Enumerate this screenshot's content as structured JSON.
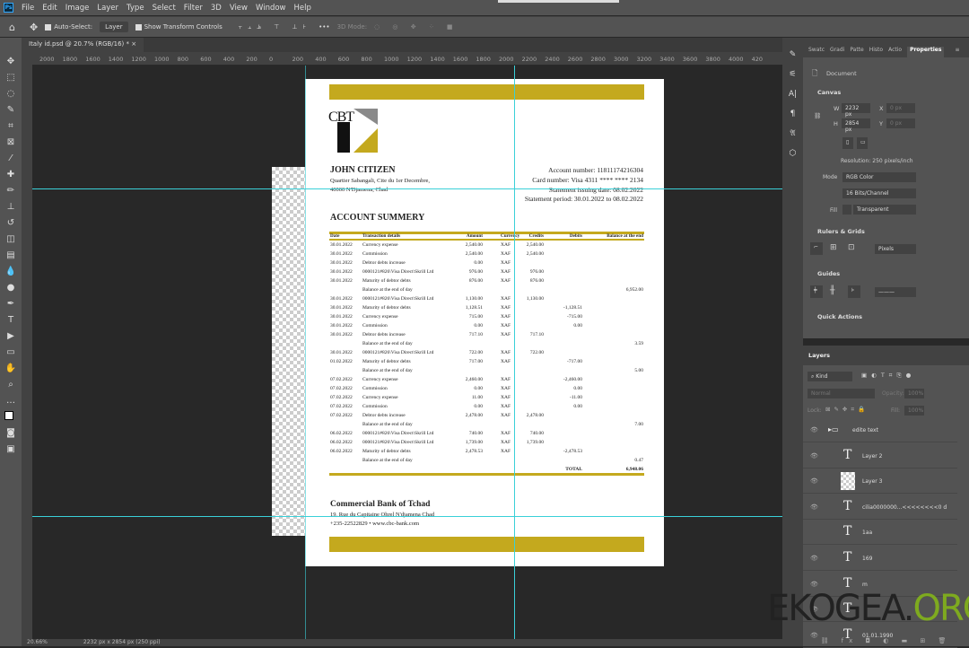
{
  "menu": [
    "File",
    "Edit",
    "Image",
    "Layer",
    "Type",
    "Select",
    "Filter",
    "3D",
    "View",
    "Window",
    "Help"
  ],
  "options": {
    "auto_select": "Auto-Select:",
    "layer_select": "Layer",
    "show_transform": "Show Transform Controls",
    "mode_3d": "3D Mode:"
  },
  "tab": {
    "title": "Italy id.psd @ 20.7% (RGB/16) *",
    "close": "×"
  },
  "ruler_labels": [
    "2000",
    "1800",
    "1600",
    "1400",
    "1200",
    "1000",
    "800",
    "600",
    "400",
    "200",
    "0",
    "200",
    "400",
    "600",
    "800",
    "1000",
    "1200",
    "1400",
    "1600",
    "1800",
    "2000",
    "2200",
    "2400",
    "2600",
    "2800",
    "3000",
    "3200",
    "3400",
    "3600",
    "3800",
    "4000",
    "420"
  ],
  "status": {
    "zoom": "20.66%",
    "doc": "2232 px x 2854 px (250 ppi)"
  },
  "document": {
    "logo_text": "CBT",
    "name": "JOHN CITIZEN",
    "address1": "Quartier Sabangali, Cite du 1er Decembre,",
    "address2": "40000 N'Djamena, Chad",
    "account": "Account number: 11811174216304",
    "card": "Card number: Visa 4311 **** **** 2134",
    "issue": "Statement issuing date: 08.02.2022",
    "period": "Statement period: 30.01.2022 to 08.02.2022",
    "summary_title": "ACCOUNT SUMMERY",
    "columns": [
      "Date",
      "Transaction details",
      "Amount",
      "Currency",
      "Credits",
      "Debits",
      "Balance at the end"
    ],
    "rows": [
      [
        "30.01.2022",
        "Currency expense",
        "2,540.00",
        "XAF",
        "2,540.00",
        "",
        ""
      ],
      [
        "30.01.2022",
        "Commission",
        "2,540.00",
        "XAF",
        "2,540.00",
        "",
        ""
      ],
      [
        "30.01.2022",
        "Debtor debts increase",
        "0.00",
        "XAF",
        "",
        "",
        ""
      ],
      [
        "30.01.2022",
        "0000121#826\\Visa Direct\\Skrill Ltd",
        "976.00",
        "XAF",
        "976.00",
        "",
        ""
      ],
      [
        "30.01.2022",
        "Maturity of debtor debts",
        "876.00",
        "XAF",
        "876.00",
        "",
        ""
      ],
      [
        "",
        "Balance at the end of day",
        "",
        "",
        "",
        "",
        "6,952.00"
      ],
      [
        "30.01.2022",
        "0000121#826\\Visa Direct\\Skrill Ltd",
        "1,130.00",
        "XAF",
        "1,130.00",
        "",
        ""
      ],
      [
        "30.01.2022",
        "Maturity of debtor debts",
        "1,128.51",
        "XAF",
        "",
        "-1,128.51",
        ""
      ],
      [
        "30.01.2022",
        "Currency expense",
        "715.00",
        "XAF",
        "",
        "-715.00",
        ""
      ],
      [
        "30.01.2022",
        "Commission",
        "0.00",
        "XAF",
        "",
        "0.00",
        ""
      ],
      [
        "30.01.2022",
        "Debtor debts increase",
        "717.10",
        "XAF",
        "717.10",
        "",
        ""
      ],
      [
        "",
        "Balance at the end of day",
        "",
        "",
        "",
        "",
        "3.59"
      ],
      [
        "30.01.2022",
        "0000121#826\\Visa Direct\\Skrill Ltd",
        "722.00",
        "XAF",
        "722.00",
        "",
        ""
      ],
      [
        "01.02.2022",
        "Maturity of debtor debts",
        "717.00",
        "XAF",
        "",
        "-717.00",
        ""
      ],
      [
        "",
        "Balance at the end of day",
        "",
        "",
        "",
        "",
        "5.00"
      ],
      [
        "07.02.2022",
        "Currency expense",
        "2,460.00",
        "XAF",
        "",
        "-2,460.00",
        ""
      ],
      [
        "07.02.2022",
        "Commission",
        "0.00",
        "XAF",
        "",
        "0.00",
        ""
      ],
      [
        "07.02.2022",
        "Currency expense",
        "11.00",
        "XAF",
        "",
        "-11.00",
        ""
      ],
      [
        "07.02.2022",
        "Commission",
        "0.00",
        "XAF",
        "",
        "0.00",
        ""
      ],
      [
        "07.02.2022",
        "Debtor debts increase",
        "2,478.00",
        "XAF",
        "2,478.00",
        "",
        ""
      ],
      [
        "",
        "Balance at the end of day",
        "",
        "",
        "",
        "",
        "7.00"
      ],
      [
        "06.02.2022",
        "0000121#826\\Visa Direct\\Skrill Ltd",
        "740.00",
        "XAF",
        "740.00",
        "",
        ""
      ],
      [
        "06.02.2022",
        "0000121#826\\Visa Direct\\Skrill Ltd",
        "1,739.00",
        "XAF",
        "1,739.00",
        "",
        ""
      ],
      [
        "06.02.2022",
        "Maturity of debtor debts",
        "2,478.53",
        "XAF",
        "",
        "-2,478.53",
        ""
      ],
      [
        "",
        "Balance at the end of day",
        "",
        "",
        "",
        "",
        "0.47"
      ]
    ],
    "total_label": "TOTAL",
    "total_value": "6,948.06",
    "bank_name": "Commercial Bank of Tchad",
    "bank_address": "19, Rue du Capitaine Ohrel N'djamena Chad",
    "bank_contact": "+235-22522829 • www.cbc-bank.com",
    "gold": "#c4a91e"
  },
  "properties": {
    "tabs": [
      "Swatc",
      "Gradi",
      "Patte",
      "Histo",
      "Actio",
      "Properties"
    ],
    "document_label": "Document",
    "canvas_title": "Canvas",
    "w_label": "W",
    "w": "2232 px",
    "h_label": "H",
    "h": "2854 px",
    "x_label": "X",
    "x": "0 px",
    "y_label": "Y",
    "y": "0 px",
    "resolution": "Resolution: 250 pixels/inch",
    "mode_label": "Mode",
    "mode": "RGB Color",
    "depth": "16 Bits/Channel",
    "fill_label": "Fill",
    "fill": "Transparent",
    "rulers_title": "Rulers & Grids",
    "units": "Pixels",
    "guides_title": "Guides",
    "quick_title": "Quick Actions"
  },
  "layers": {
    "title": "Layers",
    "kind": "Kind",
    "blend": "Normal",
    "opacity_label": "Opacity:",
    "opacity": "100%",
    "lock_label": "Lock:",
    "fill_label": "Fill:",
    "fill": "100%",
    "items": [
      {
        "name": "edite text",
        "type": "group"
      },
      {
        "name": "Layer 2",
        "type": "text"
      },
      {
        "name": "Layer 3",
        "type": "image"
      },
      {
        "name": "cilia0000000...<<<<<<<<0 d",
        "type": "text"
      },
      {
        "name": "1aa",
        "type": "text"
      },
      {
        "name": "169",
        "type": "text"
      },
      {
        "name": "m",
        "type": "text"
      },
      {
        "name": "",
        "type": "text"
      },
      {
        "name": "01.01.1990",
        "type": "text"
      }
    ]
  },
  "watermark": {
    "main": "EKOGEA.",
    "tld": "ORG"
  }
}
